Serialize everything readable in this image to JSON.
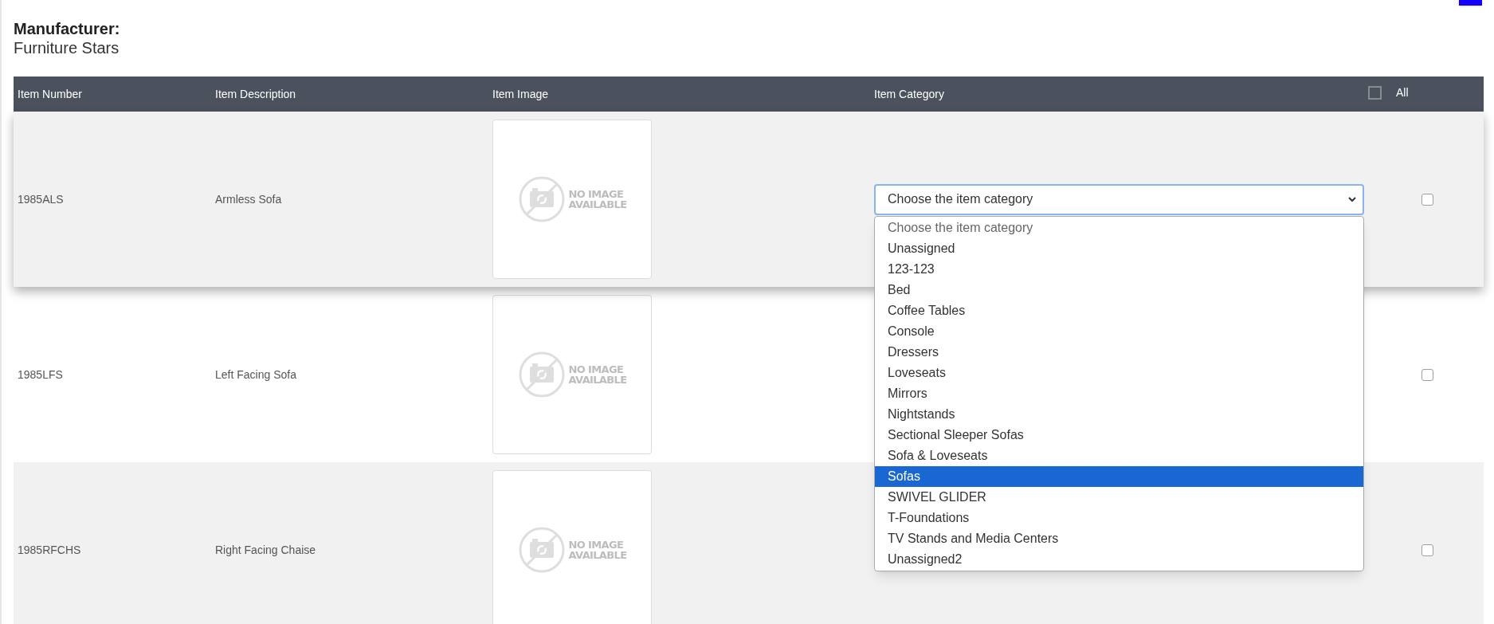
{
  "manufacturer": {
    "label": "Manufacturer:",
    "name": "Furniture Stars"
  },
  "table": {
    "columns": [
      "Item Number",
      "Item Description",
      "Item Image",
      "Item Category"
    ],
    "select_all": {
      "label": "All",
      "checked": false
    },
    "rows": [
      {
        "item_number": "1985ALS",
        "description": "Armless Sofa",
        "image_label": [
          "NO IMAGE",
          "AVAILABLE"
        ],
        "checked": false,
        "raised": true,
        "category": {
          "value": "Choose the item category",
          "open": true
        }
      },
      {
        "item_number": "1985LFS",
        "description": "Left Facing Sofa",
        "image_label": [
          "NO IMAGE",
          "AVAILABLE"
        ],
        "checked": false,
        "raised": false
      },
      {
        "item_number": "1985RFCHS",
        "description": "Right Facing Chaise",
        "image_label": [
          "NO IMAGE",
          "AVAILABLE"
        ],
        "checked": false,
        "raised": false
      }
    ]
  },
  "category_options": [
    {
      "label": "Choose the item category",
      "selected": false
    },
    {
      "label": "Unassigned",
      "selected": false
    },
    {
      "label": "123-123",
      "selected": false
    },
    {
      "label": "Bed",
      "selected": false
    },
    {
      "label": "Coffee Tables",
      "selected": false
    },
    {
      "label": "Console",
      "selected": false
    },
    {
      "label": "Dressers",
      "selected": false
    },
    {
      "label": "Loveseats",
      "selected": false
    },
    {
      "label": "Mirrors",
      "selected": false
    },
    {
      "label": "Nightstands",
      "selected": false
    },
    {
      "label": "Sectional Sleeper Sofas",
      "selected": false
    },
    {
      "label": "Sofa & Loveseats",
      "selected": false
    },
    {
      "label": "Sofas",
      "selected": true
    },
    {
      "label": "SWIVEL GLIDER",
      "selected": false
    },
    {
      "label": "T-Foundations",
      "selected": false
    },
    {
      "label": "TV Stands and Media Centers",
      "selected": false
    },
    {
      "label": "Unassigned2",
      "selected": false
    }
  ]
}
